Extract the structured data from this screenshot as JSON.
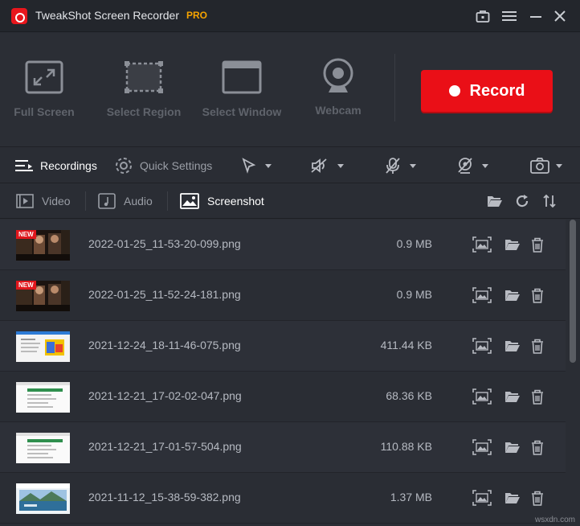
{
  "app": {
    "title": "TweakShot Screen Recorder",
    "badge": "PRO"
  },
  "titlebar_icons": [
    "toolbox-icon",
    "menu-icon",
    "minimize-icon",
    "close-icon"
  ],
  "modes": [
    {
      "label": "Full Screen",
      "icon": "fullscreen-icon"
    },
    {
      "label": "Select Region",
      "icon": "region-icon"
    },
    {
      "label": "Select Window",
      "icon": "window-icon"
    },
    {
      "label": "Webcam",
      "icon": "webcam-icon"
    }
  ],
  "record_label": "Record",
  "toolbar": {
    "recordings": "Recordings",
    "quick_settings": "Quick Settings"
  },
  "tabs": {
    "video": "Video",
    "audio": "Audio",
    "screenshot": "Screenshot",
    "active": "screenshot"
  },
  "files": [
    {
      "name": "2022-01-25_11-53-20-099.png",
      "size": "0.9 MB",
      "new": true,
      "badge": "NEW",
      "thumb": "video"
    },
    {
      "name": "2022-01-25_11-52-24-181.png",
      "size": "0.9 MB",
      "new": true,
      "badge": "NEW",
      "thumb": "video"
    },
    {
      "name": "2021-12-24_18-11-46-075.png",
      "size": "411.44 KB",
      "new": false,
      "thumb": "web-color"
    },
    {
      "name": "2021-12-21_17-02-02-047.png",
      "size": "68.36 KB",
      "new": false,
      "thumb": "web-green"
    },
    {
      "name": "2021-12-21_17-01-57-504.png",
      "size": "110.88 KB",
      "new": false,
      "thumb": "web-green"
    },
    {
      "name": "2021-11-12_15-38-59-382.png",
      "size": "1.37 MB",
      "new": false,
      "thumb": "landscape"
    }
  ],
  "watermark": "wsxdn.com",
  "colors": {
    "accent": "#ea0f17",
    "pro": "#f5a300",
    "background": "#2a2d34"
  }
}
